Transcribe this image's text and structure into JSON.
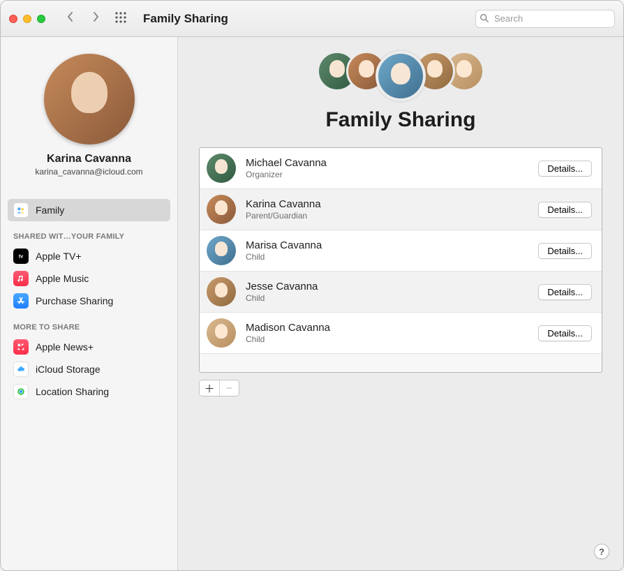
{
  "toolbar": {
    "title": "Family Sharing",
    "search_placeholder": "Search"
  },
  "profile": {
    "name": "Karina Cavanna",
    "email": "karina_cavanna@icloud.com"
  },
  "sidebar": {
    "main": [
      {
        "key": "family",
        "label": "Family",
        "selected": true
      }
    ],
    "section1_header": "SHARED WIT…YOUR FAMILY",
    "section1": [
      {
        "key": "appletv",
        "label": "Apple TV+"
      },
      {
        "key": "music",
        "label": "Apple Music"
      },
      {
        "key": "purchase",
        "label": "Purchase Sharing"
      }
    ],
    "section2_header": "MORE TO SHARE",
    "section2": [
      {
        "key": "news",
        "label": "Apple News+"
      },
      {
        "key": "icloud",
        "label": "iCloud Storage"
      },
      {
        "key": "location",
        "label": "Location Sharing"
      }
    ]
  },
  "hero_title": "Family Sharing",
  "details_label": "Details...",
  "members": [
    {
      "name": "Michael Cavanna",
      "role": "Organizer",
      "bg": "bg1"
    },
    {
      "name": "Karina Cavanna",
      "role": "Parent/Guardian",
      "bg": "bg2"
    },
    {
      "name": "Marisa Cavanna",
      "role": "Child",
      "bg": "bg3"
    },
    {
      "name": "Jesse Cavanna",
      "role": "Child",
      "bg": "bg4"
    },
    {
      "name": "Madison Cavanna",
      "role": "Child",
      "bg": "bg5"
    }
  ],
  "help_label": "?",
  "stack_order": [
    "bg1",
    "bg2",
    "bg3",
    "bg4",
    "bg5"
  ],
  "icon_colors": {
    "family": "#ffffff",
    "family_bg": "#cfcfcf",
    "appletv": "#000000",
    "music": "#fa2d48",
    "purchase": "#1f8bff",
    "news": "#fa3b55",
    "icloud": "#ffffff",
    "icloud_bg": "#ffffff",
    "location": "#34c759"
  }
}
